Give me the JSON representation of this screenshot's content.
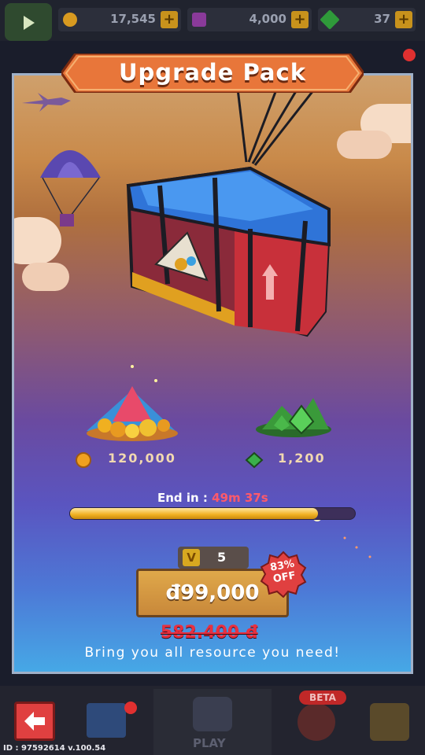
{
  "currency_bar": {
    "coins": "17,545",
    "tickets": "4,000",
    "gems": "37",
    "plus": "+"
  },
  "dialog": {
    "title": "Upgrade Pack",
    "rewards": [
      {
        "icon": "coin-icon",
        "amount": "120,000"
      },
      {
        "icon": "gem-icon",
        "amount": "1,200"
      }
    ],
    "end_label": "End in :",
    "end_time": "49m 37s",
    "timer_remaining_fraction": 0.87,
    "vip_icon": "V",
    "vip_level": "5",
    "price": "đ99,000",
    "discount_percent": "83%",
    "discount_word": "OFF",
    "original_price": "582.400 đ",
    "tagline": "Bring you all resource you need!"
  },
  "bottom_nav": {
    "play_label": "PLAY",
    "beta_label": "BETA"
  },
  "build_id": "ID : 97592614 v.100.54",
  "colors": {
    "timer_red": "#ff5a6a",
    "price_strike": "#e83040",
    "button_gold": "#d49a42",
    "badge_red": "#e04040"
  }
}
